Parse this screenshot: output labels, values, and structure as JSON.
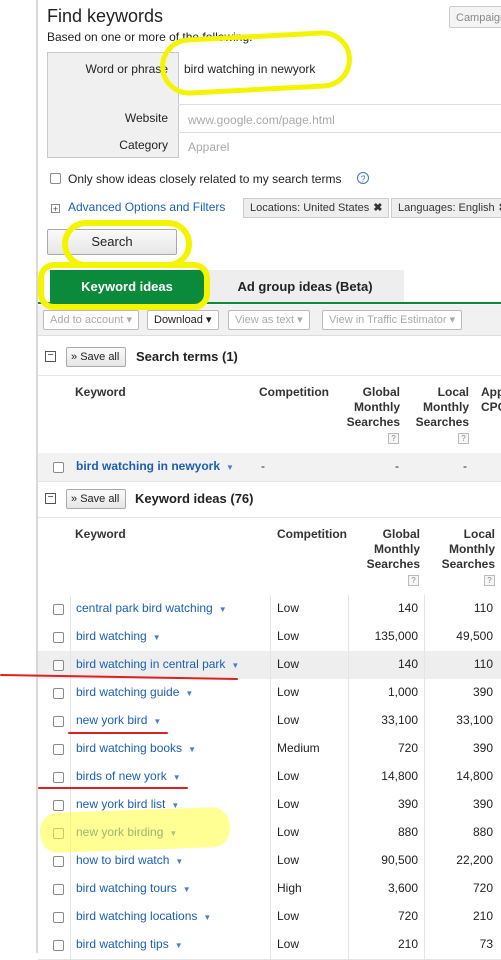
{
  "header": {
    "title": "Find keywords",
    "subtitle": "Based on one or more of the following:",
    "campaign_button": "Campaign"
  },
  "form": {
    "word_label": "Word or phrase",
    "word_value": "bird watching in newyork",
    "website_label": "Website",
    "website_placeholder": "www.google.com/page.html",
    "category_label": "Category",
    "category_placeholder": "Apparel"
  },
  "options": {
    "only_show_label": "Only show ideas closely related to my search terms",
    "help_icon": "?",
    "advanced_label": "Advanced Options and Filters",
    "locations_chip": "Locations: United States",
    "languages_chip": "Languages: English",
    "chip_close": "✖",
    "search_button": "Search"
  },
  "tabs": {
    "keyword_ideas": "Keyword ideas",
    "ad_group_ideas": "Ad group ideas (Beta)"
  },
  "toolbar": {
    "add_to_account": "Add to account",
    "download": "Download",
    "view_as_text": "View as text",
    "view_in_estimator": "View in Traffic Estimator",
    "caret": "▾"
  },
  "search_terms": {
    "save_all": "Save all",
    "title": "Search terms (1)",
    "col_keyword": "Keyword",
    "col_competition": "Competition",
    "col_global": "Global Monthly Searches",
    "col_local": "Local Monthly Searches",
    "col_app": "App CPC",
    "row": {
      "keyword": "bird watching in newyork",
      "competition": "-",
      "global": "-",
      "local": "-"
    }
  },
  "keyword_ideas": {
    "save_all": "Save all",
    "title": "Keyword ideas (76)",
    "col_keyword": "Keyword",
    "col_competition": "Competition",
    "col_global": "Global Monthly Searches",
    "col_local": "Local Monthly Searches",
    "rows": [
      {
        "keyword": "central park bird watching",
        "competition": "Low",
        "global": "140",
        "local": "110"
      },
      {
        "keyword": "bird watching",
        "competition": "Low",
        "global": "135,000",
        "local": "49,500"
      },
      {
        "keyword": "bird watching in central park",
        "competition": "Low",
        "global": "140",
        "local": "110"
      },
      {
        "keyword": "bird watching guide",
        "competition": "Low",
        "global": "1,000",
        "local": "390"
      },
      {
        "keyword": "new york bird",
        "competition": "Low",
        "global": "33,100",
        "local": "33,100"
      },
      {
        "keyword": "bird watching books",
        "competition": "Medium",
        "global": "720",
        "local": "390"
      },
      {
        "keyword": "birds of new york",
        "competition": "Low",
        "global": "14,800",
        "local": "14,800"
      },
      {
        "keyword": "new york bird list",
        "competition": "Low",
        "global": "390",
        "local": "390"
      },
      {
        "keyword": "new york birding",
        "competition": "Low",
        "global": "880",
        "local": "880"
      },
      {
        "keyword": "how to bird watch",
        "competition": "Low",
        "global": "90,500",
        "local": "22,200"
      },
      {
        "keyword": "bird watching tours",
        "competition": "High",
        "global": "3,600",
        "local": "720"
      },
      {
        "keyword": "bird watching locations",
        "competition": "Low",
        "global": "720",
        "local": "210"
      },
      {
        "keyword": "bird watching tips",
        "competition": "Low",
        "global": "210",
        "local": "73"
      }
    ]
  }
}
